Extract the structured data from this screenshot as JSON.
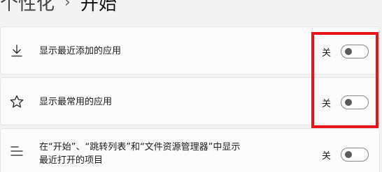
{
  "breadcrumb": {
    "parent": "个性化",
    "separator": "›",
    "current": "开始"
  },
  "settings": [
    {
      "icon": "download-icon",
      "label_lines": [
        "显示最近添加的应用"
      ],
      "state_label": "关",
      "enabled": false
    },
    {
      "icon": "star-icon",
      "label_lines": [
        "显示最常用的应用"
      ],
      "state_label": "关",
      "enabled": false
    },
    {
      "icon": "list-icon",
      "label_lines": [
        "在“开始”、“跳转列表”和“文件资源管理器”中显示",
        "最近打开的项目"
      ],
      "state_label": "关",
      "enabled": false
    }
  ],
  "annotation": {
    "highlight_color": "#e8141d"
  },
  "colors": {
    "background": "#f3f3f3",
    "card": "#fbfbfb",
    "toggle_off_knob": "#5a5a5a"
  }
}
